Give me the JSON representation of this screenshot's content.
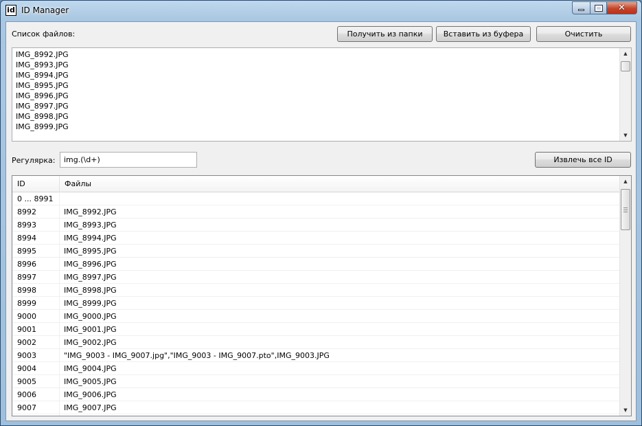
{
  "window": {
    "title": "ID Manager",
    "icon_text": "id",
    "close_glyph": "✕"
  },
  "file_list_label": "Список файлов:",
  "buttons": {
    "from_folder": "Получить из папки",
    "from_clipboard": "Вставить из буфера",
    "clear": "Очистить",
    "extract_all": "Извлечь все ID"
  },
  "file_list": [
    "IMG_8992.JPG",
    "IMG_8993.JPG",
    "IMG_8994.JPG",
    "IMG_8995.JPG",
    "IMG_8996.JPG",
    "IMG_8997.JPG",
    "IMG_8998.JPG",
    "IMG_8999.JPG"
  ],
  "regex": {
    "label": "Регулярка:",
    "value": "img.(\\d+)"
  },
  "table": {
    "columns": [
      "ID",
      "Файлы"
    ],
    "rows": [
      [
        "0 ... 8991",
        ""
      ],
      [
        "8992",
        "IMG_8992.JPG"
      ],
      [
        "8993",
        "IMG_8993.JPG"
      ],
      [
        "8994",
        "IMG_8994.JPG"
      ],
      [
        "8995",
        "IMG_8995.JPG"
      ],
      [
        "8996",
        "IMG_8996.JPG"
      ],
      [
        "8997",
        "IMG_8997.JPG"
      ],
      [
        "8998",
        "IMG_8998.JPG"
      ],
      [
        "8999",
        "IMG_8999.JPG"
      ],
      [
        "9000",
        "IMG_9000.JPG"
      ],
      [
        "9001",
        "IMG_9001.JPG"
      ],
      [
        "9002",
        "IMG_9002.JPG"
      ],
      [
        "9003",
        "\"IMG_9003 - IMG_9007.jpg\",\"IMG_9003 - IMG_9007.pto\",IMG_9003.JPG"
      ],
      [
        "9004",
        "IMG_9004.JPG"
      ],
      [
        "9005",
        "IMG_9005.JPG"
      ],
      [
        "9006",
        "IMG_9006.JPG"
      ],
      [
        "9007",
        "IMG_9007.JPG"
      ]
    ]
  },
  "icons": {
    "app": "id-app-icon",
    "minimize": "minimize-icon",
    "maximize": "maximize-icon",
    "close": "close-icon",
    "scroll_up": "scroll-up-arrow-icon",
    "scroll_down": "scroll-down-arrow-icon"
  },
  "colors": {
    "title_gradient": "#a9c7e2",
    "close_button": "#c7442a",
    "client_bg": "#f0f0f0"
  }
}
